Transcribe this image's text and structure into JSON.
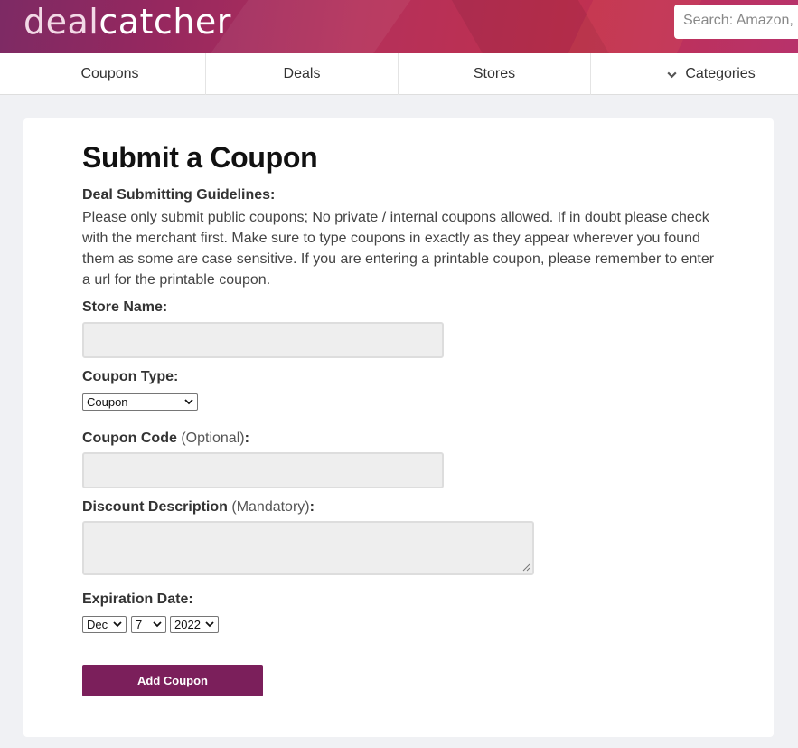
{
  "header": {
    "logo_deal": "deal",
    "logo_catcher": "catcher",
    "search_placeholder": "Search: Amazon,"
  },
  "nav": {
    "coupons": "Coupons",
    "deals": "Deals",
    "stores": "Stores",
    "categories": "Categories"
  },
  "form": {
    "title": "Submit a Coupon",
    "guidelines_title": "Deal Submitting Guidelines:",
    "guidelines_text": "Please only submit public coupons; No private / internal coupons allowed. If in doubt please check with the merchant first. Make sure to type coupons in exactly as they appear wherever you found them as some are case sensitive. If you are entering a printable coupon, please remember to enter a url for the printable coupon.",
    "store_name_label": "Store Name:",
    "coupon_type_label": "Coupon Type:",
    "coupon_type_value": "Coupon",
    "coupon_code_label": "Coupon Code",
    "coupon_code_hint": "(Optional)",
    "discount_label": "Discount Description",
    "discount_hint": "(Mandatory)",
    "colon": ":",
    "expiration_label": "Expiration Date:",
    "exp_month": "Dec",
    "exp_day": "7",
    "exp_year": "2022",
    "submit_label": "Add Coupon"
  }
}
